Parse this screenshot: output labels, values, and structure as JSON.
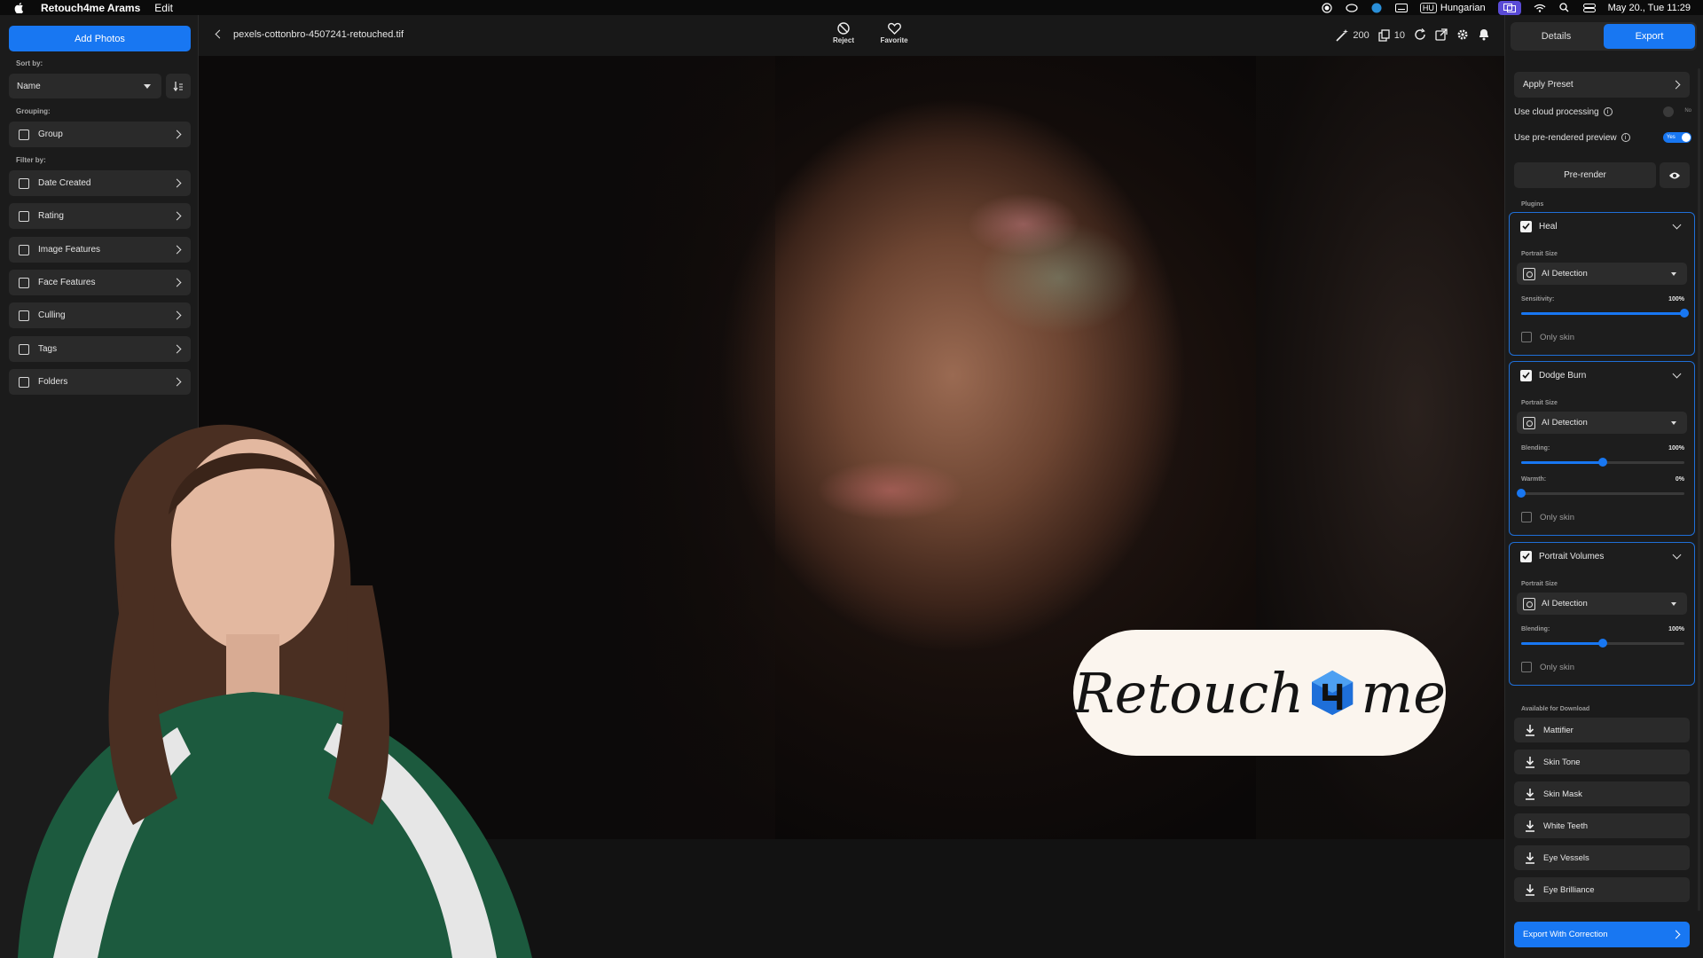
{
  "menubar": {
    "app_name": "Retouch4me Arams",
    "edit": "Edit",
    "input_source": "HU",
    "language": "Hungarian",
    "datetime": "May 20., Tue  11:29"
  },
  "sidebar": {
    "add_photos": "Add Photos",
    "sort_by_label": "Sort by:",
    "sort_value": "Name",
    "grouping_label": "Grouping:",
    "group": "Group",
    "filter_by_label": "Filter by:",
    "filters": [
      "Date Created",
      "Rating",
      "Image Features",
      "Face Features",
      "Culling",
      "Tags",
      "Folders"
    ]
  },
  "toolbar": {
    "file_name": "pexels-cottonbro-4507241-retouched.tif",
    "reject": "Reject",
    "favorite": "Favorite",
    "credits": "200",
    "count": "10"
  },
  "logo": {
    "left": "Retouch",
    "right": "me",
    "accent": "#1e6fd9"
  },
  "rpanel": {
    "tab_details": "Details",
    "tab_export": "Export",
    "apply_preset": "Apply Preset",
    "cloud_label": "Use cloud processing",
    "cloud_state": "No",
    "prerendered_label": "Use pre-rendered preview",
    "prerendered_state": "Yes",
    "prerender_btn": "Pre-render",
    "plugins_label": "Plugins",
    "plugins": [
      {
        "name": "Heal",
        "portrait_size": "Portrait Size",
        "detection": "AI Detection",
        "sliders": [
          {
            "label": "Sensitivity:",
            "value": "100%",
            "level": 1.0
          }
        ],
        "only_skin": "Only skin"
      },
      {
        "name": "Dodge Burn",
        "portrait_size": "Portrait Size",
        "detection": "AI Detection",
        "sliders": [
          {
            "label": "Blending:",
            "value": "100%",
            "level": 0.5
          },
          {
            "label": "Warmth:",
            "value": "0%",
            "level": 0.0
          }
        ],
        "only_skin": "Only skin"
      },
      {
        "name": "Portrait Volumes",
        "portrait_size": "Portrait Size",
        "detection": "AI Detection",
        "sliders": [
          {
            "label": "Blending:",
            "value": "100%",
            "level": 0.5
          }
        ],
        "only_skin": "Only skin"
      }
    ],
    "available_label": "Available for Download",
    "downloads": [
      "Mattifier",
      "Skin Tone",
      "Skin Mask",
      "White Teeth",
      "Eye Vessels",
      "Eye Brilliance"
    ],
    "export_btn": "Export With Correction"
  },
  "colors": {
    "accent": "#1877f2",
    "panel": "#1b1b1b",
    "control": "#2a2a2a"
  }
}
